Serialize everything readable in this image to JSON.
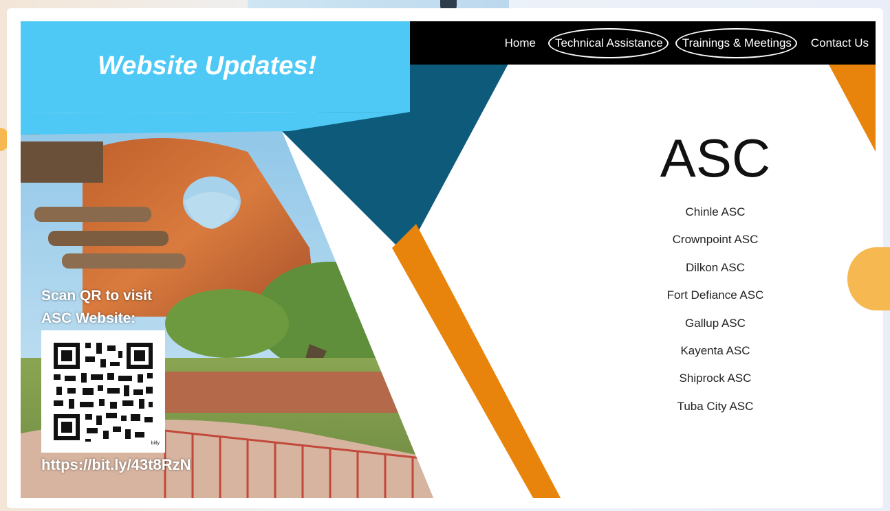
{
  "nav": {
    "items": [
      {
        "label": "Home",
        "circled": false
      },
      {
        "label": "Technical Assistance",
        "circled": true
      },
      {
        "label": "Trainings & Meetings",
        "circled": true
      },
      {
        "label": "Contact Us",
        "circled": false
      }
    ]
  },
  "banner": {
    "title": "Website Updates!"
  },
  "asc": {
    "title": "ASC",
    "locations": [
      "Chinle ASC",
      "Crownpoint ASC",
      "Dilkon ASC",
      "Fort Defiance ASC",
      "Gallup ASC",
      "Kayenta ASC",
      "Shiprock ASC",
      "Tuba City ASC"
    ]
  },
  "qr": {
    "caption_line1": "Scan QR to visit",
    "caption_line2": "ASC Website:",
    "label": "bitly",
    "url": "https://bit.ly/43t8RzN"
  },
  "colors": {
    "sky_blue": "#4ec9f5",
    "navy": "#0d5a7a",
    "orange": "#e8840c",
    "nav_bg": "#000000"
  }
}
